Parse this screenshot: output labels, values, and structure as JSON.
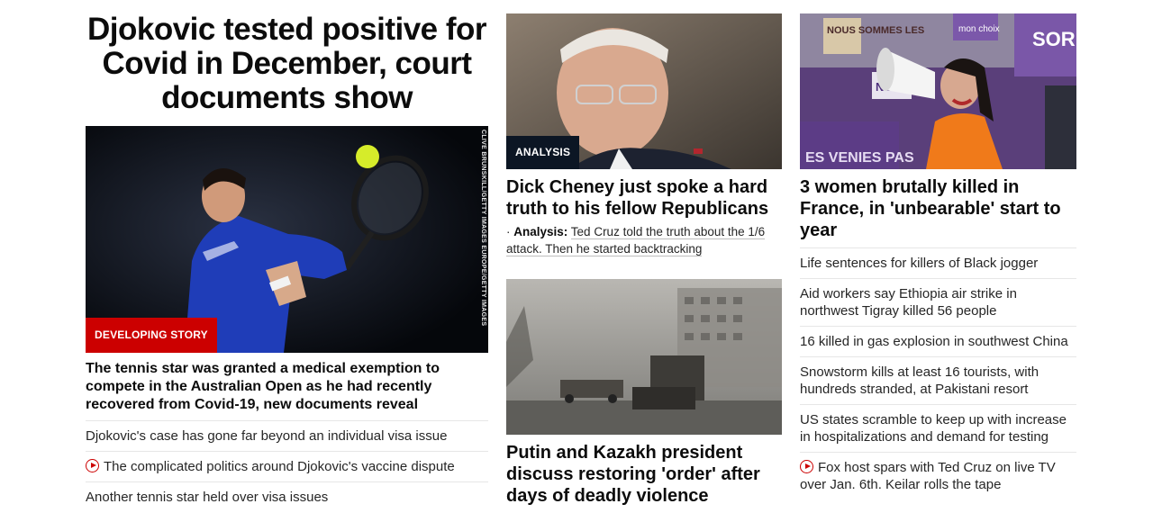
{
  "lead": {
    "headline": "Djokovic tested positive for Covid in December, court documents show",
    "badge": "DEVELOPING STORY",
    "photo_credit": "CLIVE BRUNSKILL/GETTY IMAGES EUROPE/GETTY IMAGES",
    "summary": "The tennis star was granted a medical exemption to compete in the Australian Open as he had recently recovered from Covid-19, new documents reveal",
    "related": [
      {
        "text": "Djokovic's case has gone far beyond an individual visa issue",
        "video": false
      },
      {
        "text": "The complicated politics around Djokovic's vaccine dispute",
        "video": true
      },
      {
        "text": "Another tennis star held over visa issues",
        "video": false
      }
    ]
  },
  "middle": {
    "story1": {
      "badge": "ANALYSIS",
      "headline": "Dick Cheney just spoke a hard truth to his fellow Republicans",
      "sub_label": "Analysis:",
      "sub_text": "Ted Cruz told the truth about the 1/6 attack. Then he started backtracking"
    },
    "story2": {
      "headline": "Putin and Kazakh president discuss restoring 'order' after days of deadly violence"
    }
  },
  "right": {
    "headline": "3 women brutally killed in France, in 'unbearable' start to year",
    "photo_signs": [
      "NOUS SOMMES LES",
      "mon choix",
      "SOR",
      "NOUS",
      "ES VENIES PAS"
    ],
    "list": [
      {
        "text": "Life sentences for killers of Black jogger",
        "video": false
      },
      {
        "text": "Aid workers say Ethiopia air strike in northwest Tigray killed 56 people",
        "video": false
      },
      {
        "text": "16 killed in gas explosion in southwest China",
        "video": false
      },
      {
        "text": "Snowstorm kills at least 16 tourists, with hundreds stranded, at Pakistani resort",
        "video": false
      },
      {
        "text": "US states scramble to keep up with increase in hospitalizations and demand for testing",
        "video": false
      },
      {
        "text": "Fox host spars with Ted Cruz on live TV over Jan. 6th. Keilar rolls the tape",
        "video": true
      }
    ]
  },
  "colors": {
    "badge_red": "#cc0000",
    "badge_dark": "#0c1624",
    "divider": "#e6e6e6",
    "text": "#0c0c0c"
  }
}
